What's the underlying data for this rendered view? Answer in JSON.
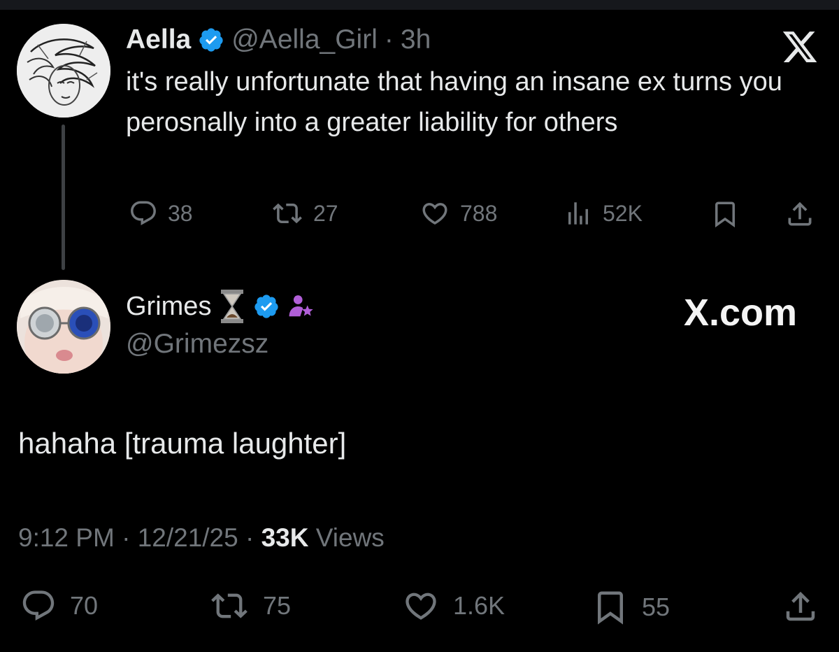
{
  "parent_tweet": {
    "name": "Aella",
    "handle": "@Aella_Girl",
    "dot": "·",
    "time": "3h",
    "text": "it's really unfortunate that having an insane ex turns you perosnally into a greater liability for others",
    "replies": "38",
    "reposts": "27",
    "likes": "788",
    "views": "52K"
  },
  "reply_tweet": {
    "name": "Grimes",
    "handle": "@Grimezsz",
    "text": "hahaha [trauma laughter]",
    "time": "9:12 PM",
    "date": "12/21/25",
    "sep": "·",
    "views_count": "33K",
    "views_label": "Views",
    "replies": "70",
    "reposts": "75",
    "likes": "1.6K",
    "bookmarks": "55"
  },
  "watermark": "X.com",
  "colors": {
    "background": "#000000",
    "primary_text": "#e7e9ea",
    "secondary_text": "#71767b",
    "verified_blue": "#1d9bf0",
    "affiliate_purple": "#b15fd8"
  }
}
